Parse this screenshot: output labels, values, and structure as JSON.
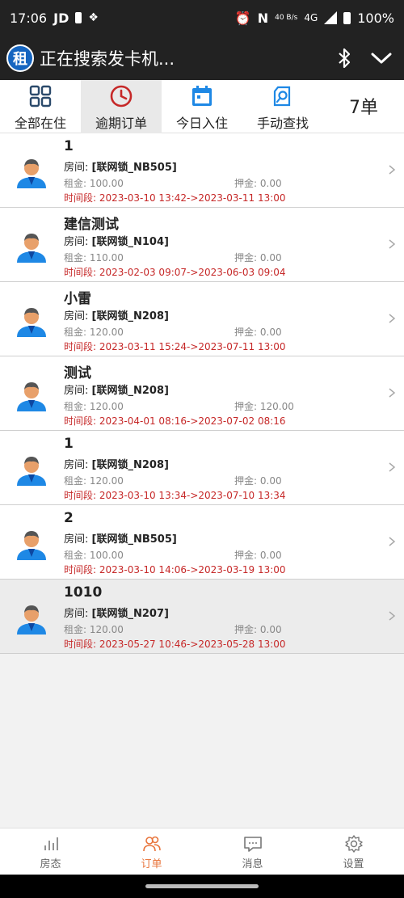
{
  "status_bar": {
    "time": "17:06",
    "carrier": "JD",
    "network_speed": "40 B/s",
    "network_type": "4G",
    "battery": "100%"
  },
  "title_bar": {
    "logo_char": "租",
    "title": "正在搜索发卡机..."
  },
  "tabs": [
    {
      "label": "全部在住",
      "icon": "grid-icon",
      "active": false
    },
    {
      "label": "逾期订单",
      "icon": "clock-icon",
      "active": true
    },
    {
      "label": "今日入住",
      "icon": "calendar-icon",
      "active": false
    },
    {
      "label": "手动查找",
      "icon": "search-doc-icon",
      "active": false
    }
  ],
  "order_count": "7单",
  "orders": [
    {
      "name": "1",
      "room_label": "房间:",
      "room": "[联网锁_NB505]",
      "rent_label": "租金:",
      "rent": "100.00",
      "deposit_label": "押金:",
      "deposit": "0.00",
      "period_label": "时间段:",
      "period": "2023-03-10 13:42->2023-03-11 13:00"
    },
    {
      "name": "建信测试",
      "room_label": "房间:",
      "room": "[联网锁_N104]",
      "rent_label": "租金:",
      "rent": "110.00",
      "deposit_label": "押金:",
      "deposit": "0.00",
      "period_label": "时间段:",
      "period": "2023-02-03 09:07->2023-06-03 09:04"
    },
    {
      "name": "小雷",
      "room_label": "房间:",
      "room": "[联网锁_N208]",
      "rent_label": "租金:",
      "rent": "120.00",
      "deposit_label": "押金:",
      "deposit": "0.00",
      "period_label": "时间段:",
      "period": "2023-03-11 15:24->2023-07-11 13:00"
    },
    {
      "name": "测试",
      "room_label": "房间:",
      "room": "[联网锁_N208]",
      "rent_label": "租金:",
      "rent": "120.00",
      "deposit_label": "押金:",
      "deposit": "120.00",
      "period_label": "时间段:",
      "period": "2023-04-01 08:16->2023-07-02 08:16"
    },
    {
      "name": "1",
      "room_label": "房间:",
      "room": "[联网锁_N208]",
      "rent_label": "租金:",
      "rent": "120.00",
      "deposit_label": "押金:",
      "deposit": "0.00",
      "period_label": "时间段:",
      "period": "2023-03-10 13:34->2023-07-10 13:34"
    },
    {
      "name": "2",
      "room_label": "房间:",
      "room": "[联网锁_NB505]",
      "rent_label": "租金:",
      "rent": "100.00",
      "deposit_label": "押金:",
      "deposit": "0.00",
      "period_label": "时间段:",
      "period": "2023-03-10 14:06->2023-03-19 13:00"
    },
    {
      "name": "1010",
      "room_label": "房间:",
      "room": "[联网锁_N207]",
      "rent_label": "租金:",
      "rent": "120.00",
      "deposit_label": "押金:",
      "deposit": "0.00",
      "period_label": "时间段:",
      "period": "2023-05-27 10:46->2023-05-28 13:00"
    }
  ],
  "bottom_nav": [
    {
      "label": "房态",
      "icon": "bar-chart-icon",
      "active": false
    },
    {
      "label": "订单",
      "icon": "users-icon",
      "active": true
    },
    {
      "label": "消息",
      "icon": "message-icon",
      "active": false
    },
    {
      "label": "设置",
      "icon": "gear-icon",
      "active": false
    }
  ],
  "colors": {
    "accent_orange": "#e8743b",
    "overdue_red": "#c62828",
    "header_dark": "#222222",
    "tab_blue": "#1e88e5"
  }
}
